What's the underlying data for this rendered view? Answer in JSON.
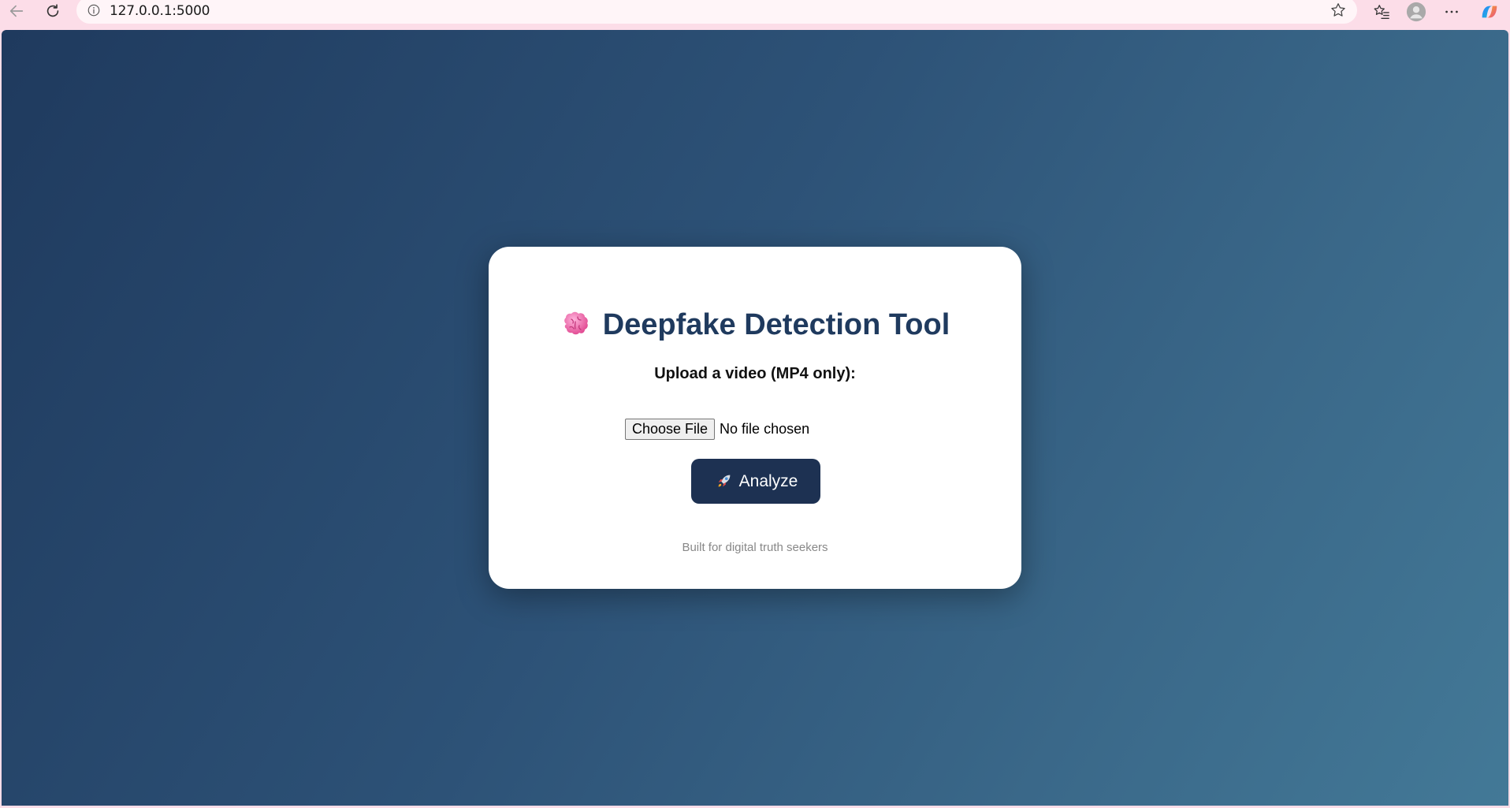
{
  "browser": {
    "url": "127.0.0.1:5000",
    "icons": {
      "back": "back-arrow-icon",
      "reload": "reload-icon",
      "site_info": "info-icon",
      "favorite": "star-icon",
      "favorites": "favorites-icon",
      "profile": "profile-icon",
      "menu": "more-icon",
      "copilot": "copilot-icon"
    }
  },
  "page": {
    "title": "Deepfake Detection Tool",
    "title_icon": "brain-icon",
    "upload_label": "Upload a video (MP4 only):",
    "file_button_label": "Choose File",
    "file_status": "No file chosen",
    "analyze_label": "Analyze",
    "analyze_icon": "rocket-icon",
    "footer": "Built for digital truth seekers"
  },
  "colors": {
    "chrome_bg": "#fcdde8",
    "gradient_start": "#1f3a5e",
    "gradient_end": "#437997",
    "title_color": "#1f3a5e",
    "button_bg": "#1d3152"
  }
}
